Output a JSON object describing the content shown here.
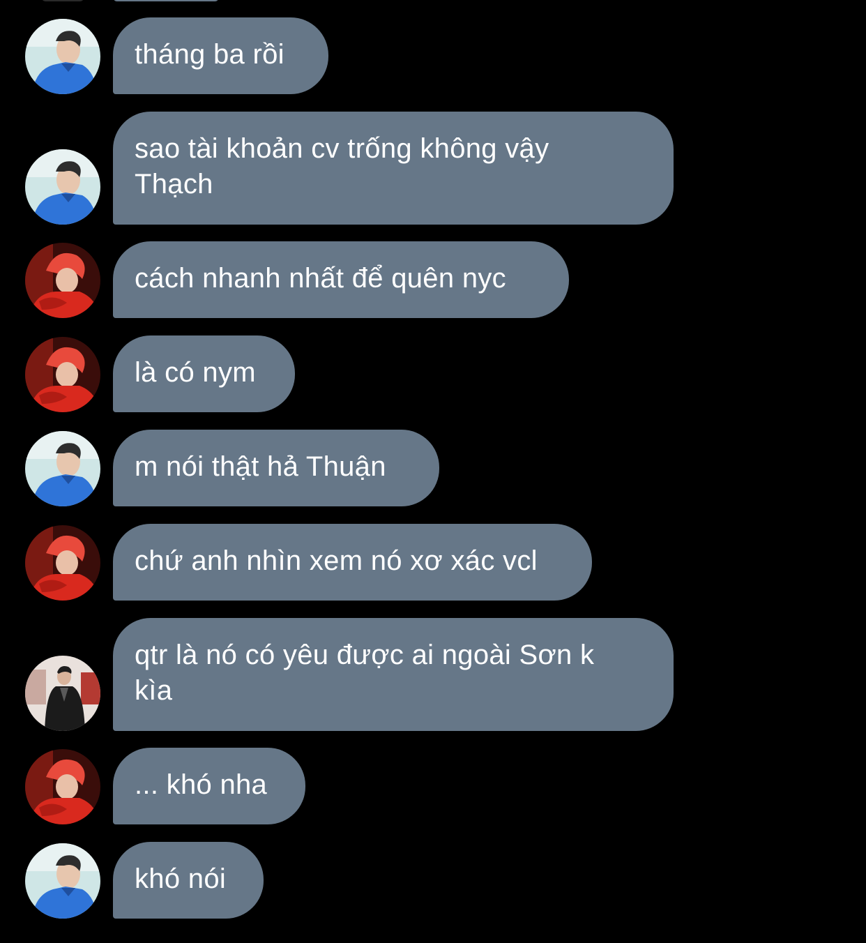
{
  "colors": {
    "background": "#000000",
    "bubble": "#667788",
    "text": "#ffffff"
  },
  "messages": [
    {
      "sender": "avatar-blue",
      "text": "tháng ba rồi"
    },
    {
      "sender": "avatar-blue",
      "text": "sao tài khoản cv trống không vậy\nThạch"
    },
    {
      "sender": "avatar-red",
      "text": "cách nhanh nhất để quên nyc"
    },
    {
      "sender": "avatar-red",
      "text": "là có nym"
    },
    {
      "sender": "avatar-blue",
      "text": "m nói thật hả Thuận"
    },
    {
      "sender": "avatar-red",
      "text": "chứ anh nhìn xem nó xơ xác vcl"
    },
    {
      "sender": "avatar-jacket",
      "text": "qtr là nó có yêu được ai ngoài Sơn k\nkìa"
    },
    {
      "sender": "avatar-red",
      "text": "... khó nha"
    },
    {
      "sender": "avatar-blue",
      "text": "khó nói"
    }
  ]
}
